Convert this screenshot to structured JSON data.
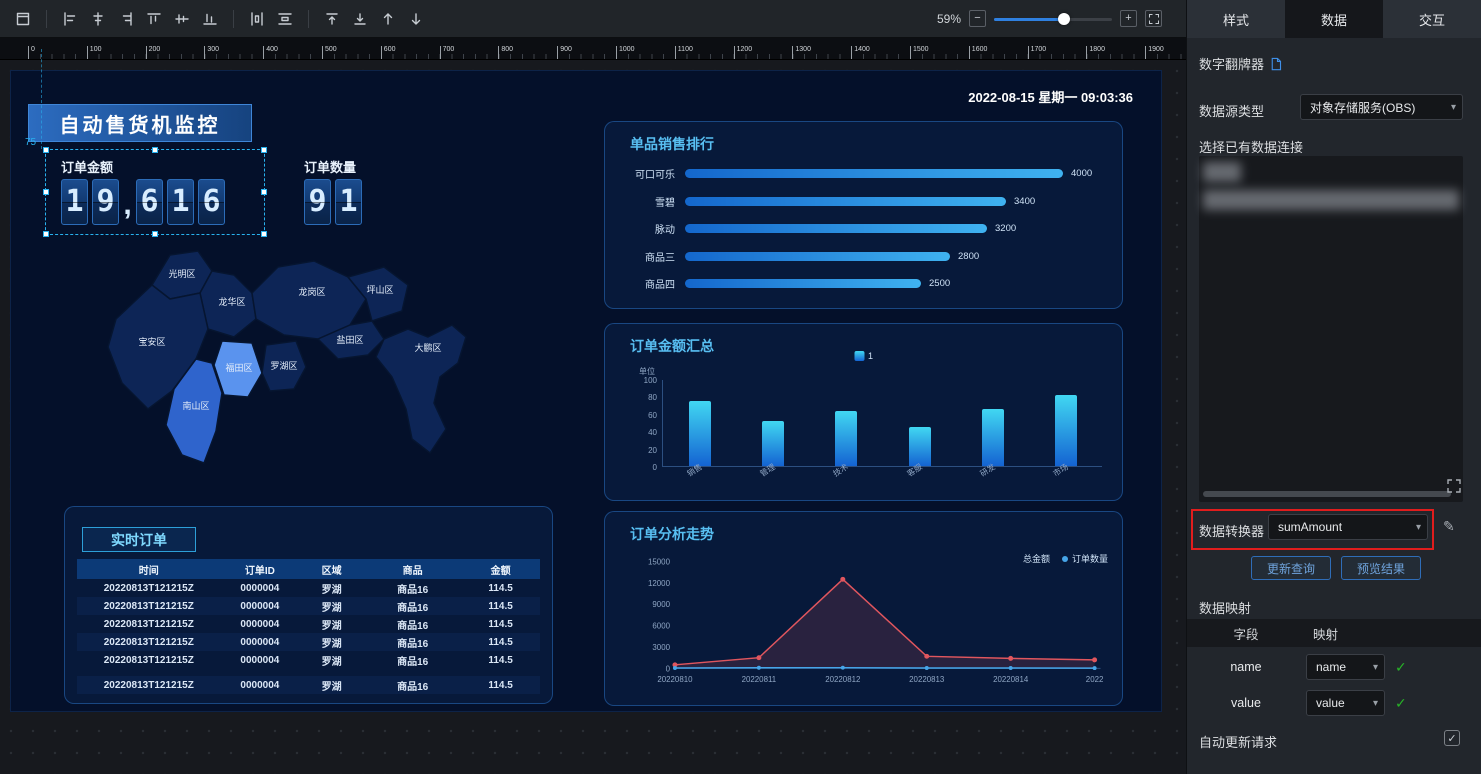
{
  "toolbar": {
    "zoom_percent": "59%",
    "zoom_value": 59
  },
  "ruler": {
    "start": 0,
    "end": 1900,
    "step": 100
  },
  "inspector": {
    "tabs": [
      {
        "label": "样式"
      },
      {
        "label": "数据"
      },
      {
        "label": "交互"
      }
    ],
    "active_tab": "数据",
    "widget_name": "数字翻牌器",
    "datasource_label": "数据源类型",
    "datasource_value": "对象存储服务(OBS)",
    "connection_label": "选择已有数据连接",
    "connection_redacted_items": 2,
    "converter_label": "数据转换器",
    "converter_value": "sumAmount",
    "update_query_button": "更新查询",
    "preview_result_button": "预览结果",
    "mapping_section_label": "数据映射",
    "mapping_headers": {
      "field": "字段",
      "mapping": "映射"
    },
    "mappings": [
      {
        "field": "name",
        "mapping": "name"
      },
      {
        "field": "value",
        "mapping": "value"
      }
    ],
    "auto_update_label": "自动更新请求"
  },
  "dashboard": {
    "title": "自动售货机监控",
    "timestamp": "2022-08-15 星期一 09:03:36",
    "kpis": [
      {
        "label": "订单金额",
        "value": "19,616"
      },
      {
        "label": "订单数量",
        "value": "91"
      }
    ],
    "selection_distance": "75",
    "panels": {
      "product_rank_title": "单品销售排行",
      "amount_summary_title": "订单金额汇总",
      "realtime_orders_title": "实时订单",
      "trend_title": "订单分析走势"
    }
  },
  "chart_data": [
    {
      "type": "bar",
      "orientation": "horizontal",
      "title": "单品销售排行",
      "categories": [
        "可口可乐",
        "雪碧",
        "脉动",
        "商品三",
        "商品四"
      ],
      "values": [
        4000,
        3400,
        3200,
        2800,
        2500
      ],
      "xlim": [
        0,
        4000
      ]
    },
    {
      "type": "bar",
      "title": "订单金额汇总",
      "legend": [
        "1"
      ],
      "ylabel": "单位",
      "categories": [
        "销售",
        "管理",
        "技术",
        "客服",
        "研发",
        "市场"
      ],
      "values": [
        75,
        52,
        63,
        45,
        65,
        82
      ],
      "ylim": [
        0,
        100
      ],
      "yticks": [
        0,
        20,
        40,
        60,
        80,
        100
      ]
    },
    {
      "type": "line",
      "title": "订单分析走势",
      "x": [
        "20220810",
        "20220811",
        "20220812",
        "20220813",
        "20220814",
        "2022"
      ],
      "series": [
        {
          "name": "总金额",
          "color": "#e0565e",
          "values": [
            500,
            1500,
            12500,
            1700,
            1400,
            1200
          ]
        },
        {
          "name": "订单数量",
          "color": "#46a5e8",
          "values": [
            50,
            80,
            91,
            60,
            50,
            40
          ]
        }
      ],
      "ylim": [
        0,
        15000
      ],
      "yticks": [
        0,
        3000,
        6000,
        9000,
        12000,
        15000
      ],
      "legend_position": "top-right"
    },
    {
      "type": "table",
      "title": "实时订单",
      "columns": [
        "时间",
        "订单ID",
        "区域",
        "商品",
        "金额"
      ],
      "rows": [
        [
          "20220813T121215Z",
          "0000004",
          "罗湖",
          "商品16",
          "114.5"
        ],
        [
          "20220813T121215Z",
          "0000004",
          "罗湖",
          "商品16",
          "114.5"
        ],
        [
          "20220813T121215Z",
          "0000004",
          "罗湖",
          "商品16",
          "114.5"
        ],
        [
          "20220813T121215Z",
          "0000004",
          "罗湖",
          "商品16",
          "114.5"
        ],
        [
          "20220813T121215Z",
          "0000004",
          "罗湖",
          "商品16",
          "114.5"
        ],
        [
          "20220813T121215Z",
          "0000004",
          "罗湖",
          "商品16",
          "114.5"
        ]
      ]
    },
    {
      "type": "map",
      "regions": [
        "光明区",
        "龙华区",
        "宝安区",
        "龙岗区",
        "坪山区",
        "盐田区",
        "南山区",
        "福田区",
        "罗湖区",
        "大鹏区"
      ],
      "highlighted": [
        "南山区",
        "福田区"
      ]
    }
  ]
}
